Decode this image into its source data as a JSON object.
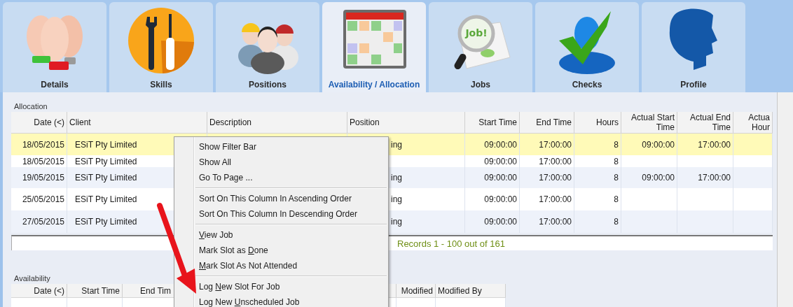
{
  "tabs": [
    {
      "label": "Details",
      "selected": false
    },
    {
      "label": "Skills",
      "selected": false
    },
    {
      "label": "Positions",
      "selected": false
    },
    {
      "label": "Availability / Allocation",
      "selected": true
    },
    {
      "label": "Jobs",
      "icon_text": "Job!",
      "selected": false
    },
    {
      "label": "Checks",
      "selected": false
    },
    {
      "label": "Profile",
      "selected": false
    }
  ],
  "allocation": {
    "title": "Allocation",
    "columns": [
      {
        "label": "Date (<)"
      },
      {
        "label": "Client"
      },
      {
        "label": "Description"
      },
      {
        "label": "Position"
      },
      {
        "label": "Start Time"
      },
      {
        "label": "End Time"
      },
      {
        "label": "Hours"
      },
      {
        "label": "Actual Start Time"
      },
      {
        "label": "Actual End Time"
      },
      {
        "label": "Actua Hour"
      }
    ],
    "rows": [
      {
        "selected": true,
        "cells": [
          "18/05/2015",
          "ESiT Pty Limited",
          null,
          "ing",
          "09:00:00",
          "17:00:00",
          "8",
          "09:00:00",
          "17:00:00",
          null
        ]
      },
      {
        "selected": false,
        "cells": [
          "18/05/2015",
          "ESiT Pty Limited",
          null,
          null,
          "09:00:00",
          "17:00:00",
          "8",
          null,
          null,
          null
        ]
      },
      {
        "selected": false,
        "cells": [
          "19/05/2015",
          "ESiT Pty Limited",
          null,
          "ing",
          "09:00:00",
          "17:00:00",
          "8",
          "09:00:00",
          "17:00:00",
          null
        ]
      },
      {
        "selected": false,
        "cells": [
          "25/05/2015",
          "ESiT Pty Limited",
          null,
          "ing",
          "09:00:00",
          "17:00:00",
          "8",
          null,
          null,
          null
        ]
      },
      {
        "selected": false,
        "cells": [
          "27/05/2015",
          "ESiT Pty Limited",
          null,
          "ing",
          "09:00:00",
          "17:00:00",
          "8",
          null,
          null,
          null
        ]
      }
    ],
    "pager": "Records 1 - 100 out of 161"
  },
  "availability": {
    "title": "Availability",
    "columns": [
      {
        "label": "Date (<)"
      },
      {
        "label": "Start Time"
      },
      {
        "label": "End Tim"
      },
      {},
      {},
      {
        "label": "Modified"
      },
      {
        "label": "Modified By"
      }
    ]
  },
  "context_menu": {
    "groups": [
      [
        {
          "text": "Show Filter Bar"
        },
        {
          "text": "Show All"
        },
        {
          "text": "Go To Page ..."
        }
      ],
      [
        {
          "text": "Sort On This Column In Ascending Order"
        },
        {
          "text": "Sort On This Column In Descending Order"
        }
      ],
      [
        {
          "key": "V",
          "after": "iew Job"
        },
        {
          "before": "Mark Slot as ",
          "key": "D",
          "after": "one"
        },
        {
          "key": "M",
          "after": "ark Slot As Not Attended"
        }
      ],
      [
        {
          "before": "Log ",
          "key": "N",
          "after": "ew Slot For Job"
        },
        {
          "before": "Log New ",
          "key": "U",
          "after": "nscheduled Job"
        }
      ]
    ]
  },
  "annotation": {
    "kind": "arrow"
  }
}
